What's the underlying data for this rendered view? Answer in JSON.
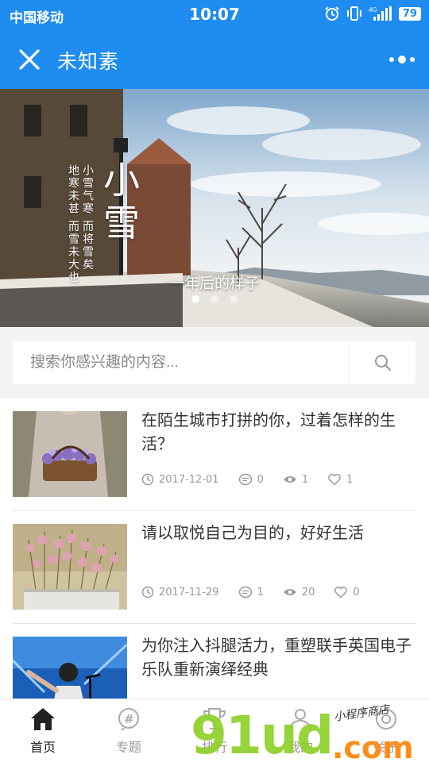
{
  "status_bar": {
    "carrier": "中国移动",
    "time": "10:07",
    "signal": "4G",
    "battery": "79"
  },
  "nav": {
    "title": "未知素"
  },
  "banner": {
    "big_text": "小雪",
    "vertical_lines": [
      "小雪气寒 而将雪矣",
      "地寒未甚 而雪未大也"
    ],
    "caption": "一年后的样子",
    "dots": 3,
    "active_dot": 0
  },
  "search": {
    "placeholder": "搜索你感兴趣的内容..."
  },
  "articles": [
    {
      "title": "在陌生城市打拼的你，过着怎样的生活？",
      "date": "2017-12-01",
      "comments": "0",
      "views": "1",
      "likes": "1"
    },
    {
      "title": "请以取悦自己为目的，好好生活",
      "date": "2017-11-29",
      "comments": "1",
      "views": "20",
      "likes": "0"
    },
    {
      "title": "为你注入抖腿活力，重塑联手英国电子乐队重新演绎经典"
    }
  ],
  "tabs": [
    {
      "label": "首页",
      "icon": "home-icon",
      "active": true
    },
    {
      "label": "专题",
      "icon": "topic-icon"
    },
    {
      "label": "排行",
      "icon": "trophy-icon"
    },
    {
      "label": "我的",
      "icon": "user-icon"
    },
    {
      "label": "关于",
      "icon": "info-icon"
    }
  ],
  "watermark": {
    "main": "91ud",
    "com": ".com",
    "sub": "小程序商店"
  },
  "colors": {
    "brand": "#1e8cf0"
  }
}
